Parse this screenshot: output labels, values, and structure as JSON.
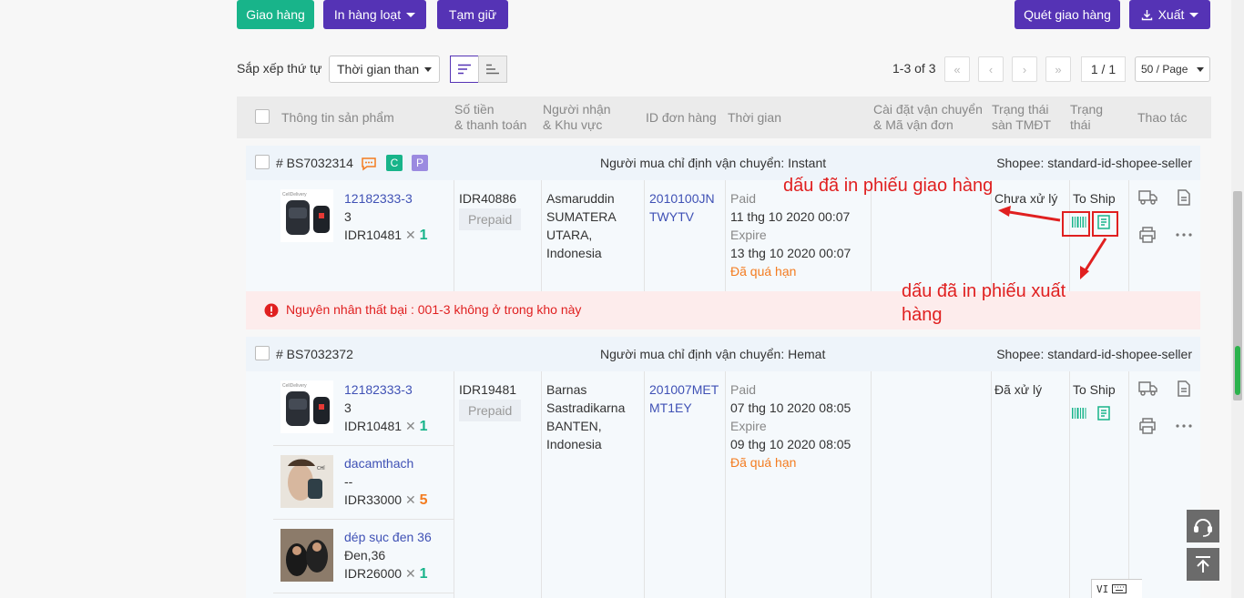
{
  "toolbar": {
    "ship_label": "Giao hàng",
    "batch_print_label": "In hàng loạt",
    "hold_label": "Tạm giữ",
    "scan_ship_label": "Quét giao hàng",
    "export_label": "Xuất"
  },
  "sort": {
    "label": "Sắp xếp thứ tự",
    "selected": "Thời gian than"
  },
  "pagination": {
    "range": "1-3 of 3",
    "page": "1 / 1",
    "per_page": "50 / Page"
  },
  "table": {
    "headers": {
      "product": "Thông tin sản phẩm",
      "amount_1": "Số tiền",
      "amount_2": "& thanh toán",
      "recipient_1": "Người nhận",
      "recipient_2": "& Khu vực",
      "order_id": "ID đơn hàng",
      "time": "Thời gian",
      "shipping_1": "Cài đặt vận chuyển",
      "shipping_2": "& Mã vận đơn",
      "platform_status_1": "Trạng thái",
      "platform_status_2": "sàn TMĐT",
      "status_1": "Trạng",
      "status_2": "thái",
      "actions": "Thao tác"
    }
  },
  "orders": [
    {
      "code": "# BS7032314",
      "badge_c": "C",
      "badge_p": "P",
      "buyer_shipping": "Người mua chỉ định vận chuyển: Instant",
      "shop": "Shopee: standard-id-shopee-seller",
      "products": [
        {
          "sku": "12182333-3",
          "variant": "3",
          "price": "IDR10481",
          "times": "✕",
          "qty": "1"
        }
      ],
      "amount": "IDR40886",
      "payment": "Prepaid",
      "recipient": [
        "Asmaruddin",
        "SUMATERA",
        "UTARA,",
        "Indonesia"
      ],
      "order_id": [
        "2010100JN",
        "TWYTV"
      ],
      "paid_label": "Paid",
      "paid_time": "11 thg 10 2020 00:07",
      "expire_label": "Expire",
      "expire_time": "13 thg 10 2020 00:07",
      "overdue": "Đã quá hạn",
      "platform_status": "Chưa xử lý",
      "status": "To Ship",
      "error": "Nguyên nhân thất bại : 001-3 không ở trong kho này"
    },
    {
      "code": "# BS7032372",
      "buyer_shipping": "Người mua chỉ định vận chuyển: Hemat",
      "shop": "Shopee: standard-id-shopee-seller",
      "products": [
        {
          "sku": "12182333-3",
          "variant": "3",
          "price": "IDR10481",
          "times": "✕",
          "qty": "1"
        },
        {
          "sku": "dacamthach",
          "variant": "--",
          "price": "IDR33000",
          "times": "✕",
          "qty": "5"
        },
        {
          "sku": "dép sục đen 36",
          "variant": "Đen,36",
          "price": "IDR26000",
          "times": "✕",
          "qty": "1"
        }
      ],
      "amount": "IDR19481",
      "payment": "Prepaid",
      "recipient": [
        "Barnas",
        "Sastradikarna",
        "BANTEN,",
        "Indonesia"
      ],
      "order_id": [
        "201007MET",
        "MT1EY"
      ],
      "paid_label": "Paid",
      "paid_time": "07 thg 10 2020 08:05",
      "expire_label": "Expire",
      "expire_time": "09 thg 10 2020 08:05",
      "overdue": "Đã quá hạn",
      "platform_status": "Đã xử lý",
      "status": "To Ship"
    }
  ],
  "annotations": {
    "delivery_note": "dấu đã in phiếu giao hàng",
    "export_note_1": "dấu đã in phiếu xuất",
    "export_note_2": "hàng"
  },
  "ime": "VI",
  "colors": {
    "green": "#18b48a",
    "purple": "#5533b5",
    "annotation_red": "#e02020",
    "overdue_orange": "#f47c20"
  }
}
